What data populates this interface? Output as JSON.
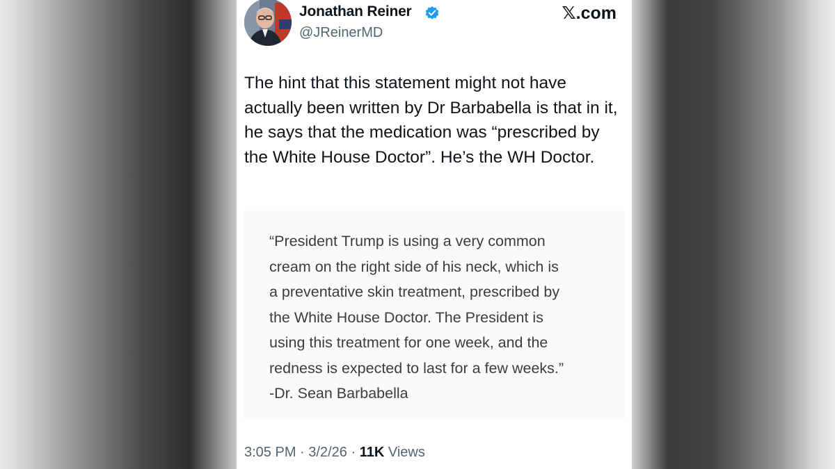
{
  "tweet": {
    "author_name": "Jonathan Reiner",
    "handle": "@JReinerMD",
    "brand": "𝕏.com",
    "verified_icon": "verified-badge-icon",
    "text": "The hint that this statement might not have actually been written by Dr Barbabella is that in it, he says that the medication was “prescribed by the White House Doctor”. He’s the WH Doctor.",
    "quoted_statement": "“President Trump is using a very common\ncream on the right side of his neck, which is\na preventative skin treatment, prescribed by\nthe White House Doctor. The President is\nusing this treatment for one week, and the\nredness is expected to last for a few weeks.”\n-Dr. Sean Barbabella",
    "time": "3:05 PM",
    "date": "3/2/26",
    "views_count": "11K",
    "views_label": "Views",
    "separator": "·"
  },
  "colors": {
    "verified_blue": "#1d9bf0",
    "secondary_text": "#536471",
    "primary_text": "#0f1419"
  }
}
